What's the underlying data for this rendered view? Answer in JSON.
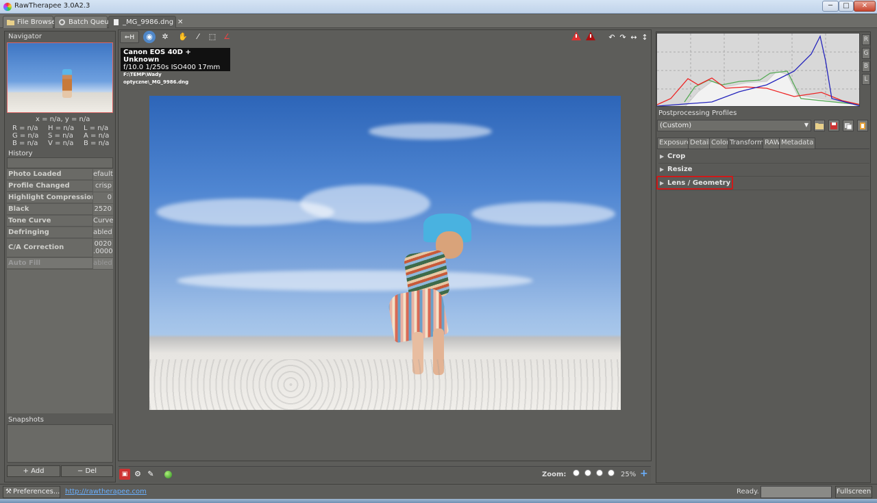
{
  "window": {
    "title": "RawTherapee 3.0A2.3",
    "controls": [
      "─",
      "□",
      "✕"
    ]
  },
  "tabs": [
    {
      "label": "File Browser"
    },
    {
      "label": "Batch Queue"
    },
    {
      "label": "_MG_9986.dng",
      "close": "✕"
    }
  ],
  "navigator": {
    "title": "Navigator",
    "coords": "x = n/a, y = n/a",
    "rgb": [
      "R = n/a",
      "G = n/a",
      "B = n/a"
    ],
    "hsv": [
      "H = n/a",
      "S = n/a",
      "V = n/a"
    ],
    "lab": [
      "L = n/a",
      "A = n/a",
      "B = n/a"
    ]
  },
  "history": {
    "title": "History",
    "items": [
      {
        "name": "Photo Loaded",
        "value": "efault"
      },
      {
        "name": "Profile Changed",
        "value": "crisp"
      },
      {
        "name": "Highlight Compression",
        "value": "0"
      },
      {
        "name": "Black",
        "value": "2520"
      },
      {
        "name": "Tone Curve",
        "value": "Curve"
      },
      {
        "name": "Defringing",
        "value": "abled"
      },
      {
        "name": "C/A Correction",
        "value": "0020\n.0000"
      },
      {
        "name": "Auto Fill",
        "value": "abled"
      }
    ]
  },
  "snapshots": {
    "title": "Snapshots",
    "add": "+ Add",
    "del": "− Del"
  },
  "toolbar": {
    "hide_label": "H"
  },
  "exif": {
    "camera": "Canon EOS 40D + Unknown",
    "aperture": "f/10.0",
    "shutter": "1/250s",
    "iso": "ISO400",
    "focal": "17mm",
    "path": "F:\\TEMP\\Wady optyczne\\_MG_9986.dng"
  },
  "bottom": {
    "zoom_label": "Zoom:",
    "zoom_value": "25%",
    "zoom_plus": "+"
  },
  "right": {
    "histogram_buttons": [
      "R",
      "G",
      "B",
      "L"
    ],
    "profiles_title": "Postprocessing Profiles",
    "profile_value": "(Custom)",
    "tool_tabs": [
      "Exposure",
      "Detail",
      "Color",
      "Transform",
      "RAW",
      "Metadata"
    ],
    "active_tab": "Transform",
    "sections": [
      "Crop",
      "Resize",
      "Lens / Geometry"
    ]
  },
  "status": {
    "preferences": "Preferences...",
    "link": "http://rawtherapee.com",
    "ready": "Ready.",
    "fullscreen": "Fullscreen"
  },
  "colors": {
    "accent_red": "#d01818",
    "histogram_bg": "#d8d8d8",
    "panel_bg": "#5a5a57"
  }
}
